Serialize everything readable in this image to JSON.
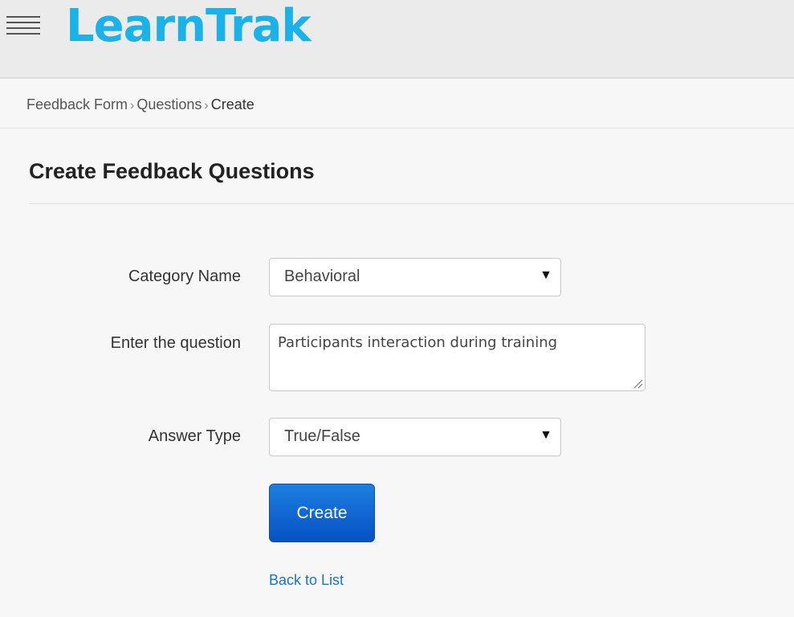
{
  "header": {
    "logo_text": "LearnTrak",
    "menu_icon": "hamburger-menu-icon",
    "brand_color": "#1ab2e8"
  },
  "breadcrumb": {
    "items": [
      "Feedback Form",
      "Questions",
      "Create"
    ],
    "separator_icon": "chevron-right-icon"
  },
  "page": {
    "title": "Create Feedback Questions"
  },
  "form": {
    "category": {
      "label": "Category Name",
      "value": "Behavioral"
    },
    "question": {
      "label": "Enter the question",
      "value": "Participants interaction during training"
    },
    "answer_type": {
      "label": "Answer Type",
      "value": "True/False"
    },
    "dropdown_icon": "caret-down-icon",
    "submit_label": "Create",
    "back_link_label": "Back to List"
  }
}
